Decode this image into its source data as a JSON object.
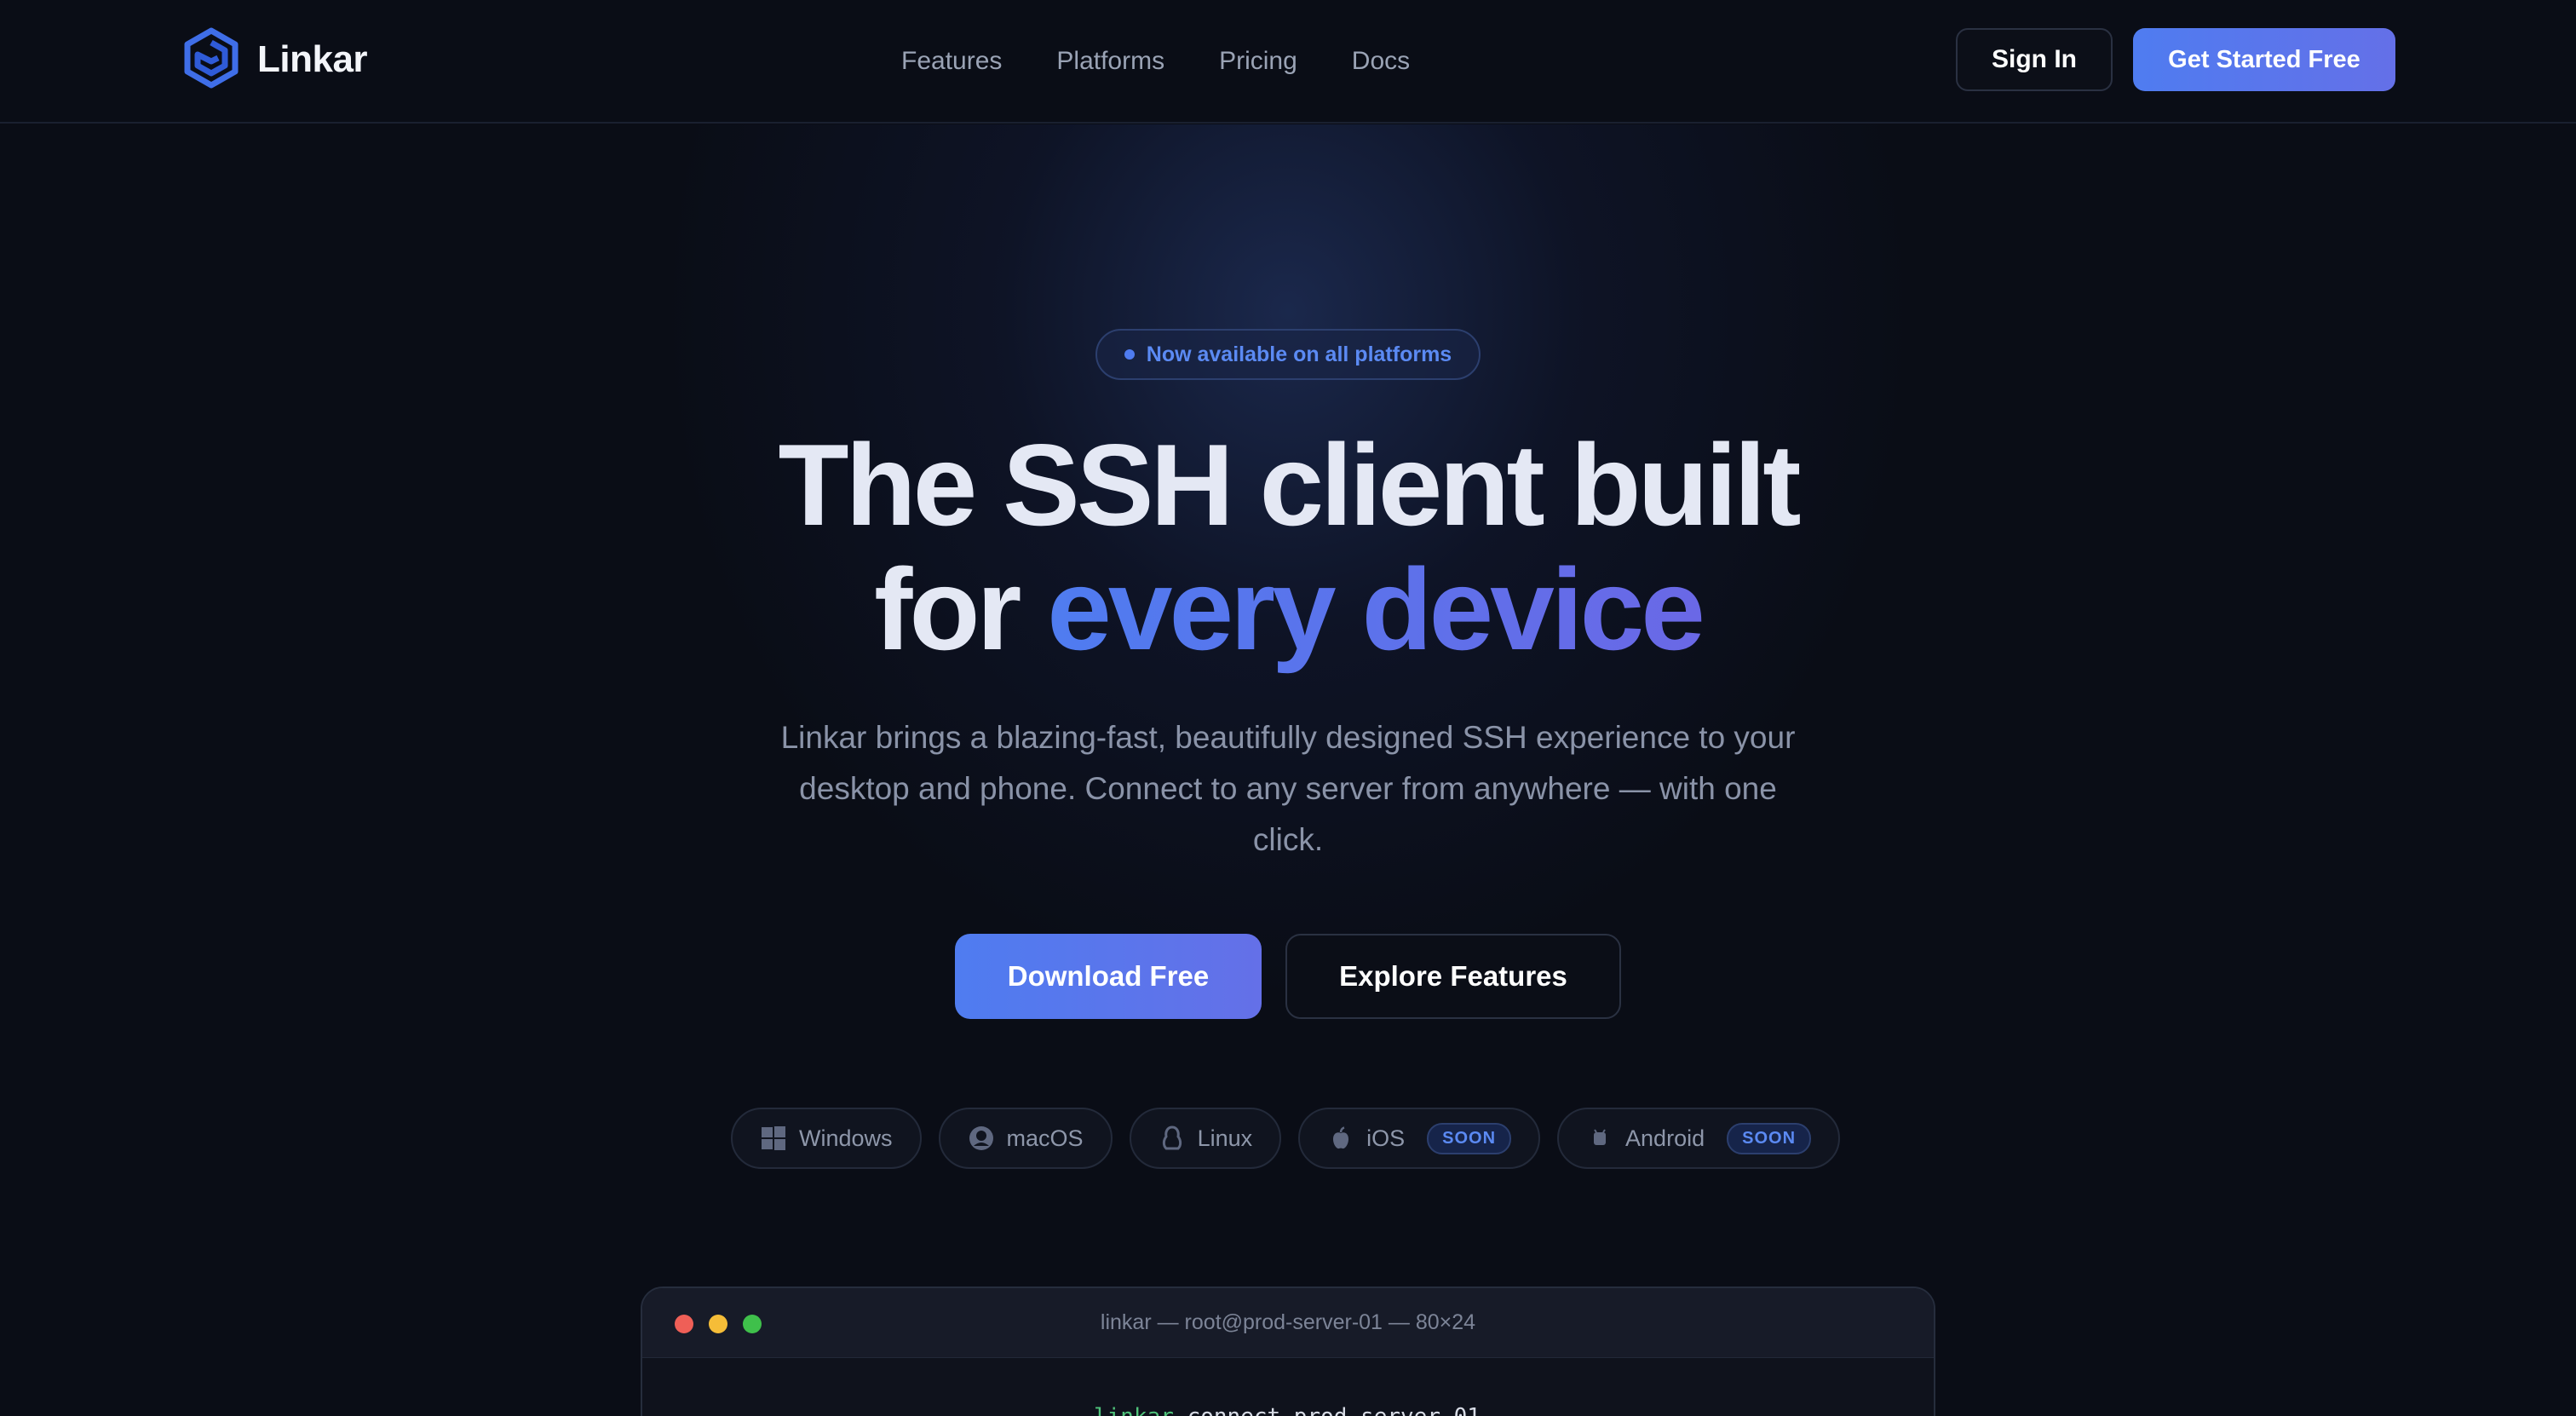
{
  "brand": {
    "name": "Linkar",
    "icon": "linkar-logo-icon",
    "color": "#4f7cf0"
  },
  "nav": {
    "items": [
      {
        "label": "Features"
      },
      {
        "label": "Platforms"
      },
      {
        "label": "Pricing"
      },
      {
        "label": "Docs"
      }
    ]
  },
  "header": {
    "sign_in_label": "Sign In",
    "get_started_label": "Get Started Free"
  },
  "hero": {
    "badge": "Now available on all platforms",
    "title_line1": "The SSH client built",
    "title_line2_prefix": "for ",
    "title_line2_accent": "every device",
    "subtitle": "Linkar brings a blazing-fast, beautifully designed SSH experience to your desktop and phone. Connect to any server from anywhere — with one click.",
    "primary_cta": "Download Free",
    "secondary_cta": "Explore Features"
  },
  "platforms": [
    {
      "label": "Windows",
      "icon": "windows-icon"
    },
    {
      "label": "macOS",
      "icon": "macos-icon"
    },
    {
      "label": "Linux",
      "icon": "linux-icon"
    },
    {
      "label": "iOS",
      "icon": "apple-icon",
      "badge": "SOON"
    },
    {
      "label": "Android",
      "icon": "android-icon",
      "badge": "SOON"
    }
  ],
  "terminal": {
    "title": "linkar — root@prod-server-01 — 80×24",
    "command": "linkar",
    "args": " connect prod-server-01"
  },
  "colors": {
    "accent": "#4f7cf0",
    "accent_end": "#6a68e6",
    "background": "#0a0d16"
  }
}
